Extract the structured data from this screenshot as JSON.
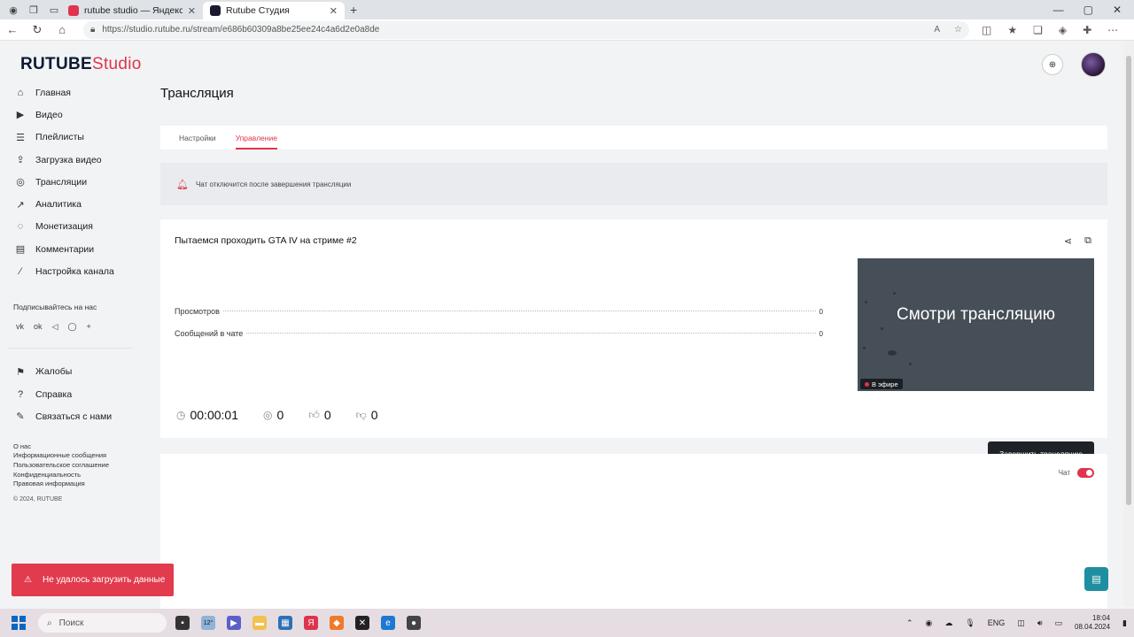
{
  "browser": {
    "tabs": [
      {
        "title": "rutube studio — Яндекс: нашлс",
        "active": false,
        "favicon_color": "#e0334d"
      },
      {
        "title": "Rutube Студия",
        "active": true,
        "favicon_color": "#1a1a2e"
      }
    ],
    "url": "https://studio.rutube.ru/stream/e686b60309a8be25ee24c4a6d2e0a8de"
  },
  "app": {
    "logo_rutube": "RUTUBE",
    "logo_studio": "Studio",
    "page_title": "Трансляция",
    "nav": [
      {
        "label": "Главная",
        "icon": "home-icon"
      },
      {
        "label": "Видео",
        "icon": "video-icon"
      },
      {
        "label": "Плейлисты",
        "icon": "playlist-icon"
      },
      {
        "label": "Загрузка видео",
        "icon": "upload-icon"
      },
      {
        "label": "Трансляции",
        "icon": "broadcast-icon"
      },
      {
        "label": "Аналитика",
        "icon": "analytics-icon"
      },
      {
        "label": "Монетизация",
        "icon": "monetization-icon"
      },
      {
        "label": "Комментарии",
        "icon": "comments-icon"
      },
      {
        "label": "Настройка канала",
        "icon": "wand-icon"
      }
    ],
    "subscribe_label": "Подписывайтесь на нас",
    "socials": [
      "vk",
      "ok",
      "telegram",
      "viber",
      "plus"
    ],
    "secondary_nav": [
      {
        "label": "Жалобы",
        "icon": "flag-icon"
      },
      {
        "label": "Справка",
        "icon": "help-icon"
      },
      {
        "label": "Связаться с нами",
        "icon": "edit-icon"
      }
    ],
    "footer_links": [
      "О нас",
      "Информационные сообщения",
      "Пользовательское соглашение",
      "Конфиденциальность",
      "Правовая информация"
    ],
    "copyright": "© 2024, RUTUBE",
    "tabs": [
      {
        "label": "Настройки",
        "active": false
      },
      {
        "label": "Управление",
        "active": true
      }
    ],
    "notice": "Чат отключится после завершения трансляции",
    "stream": {
      "title": "Пытаемся проходить GTA IV на стриме #2",
      "stats": [
        {
          "label": "Просмотров",
          "value": "0"
        },
        {
          "label": "Сообщений в чате",
          "value": "0"
        }
      ],
      "preview_text": "Смотри трансляцию",
      "live_badge": "В эфире",
      "duration": "00:00:01",
      "viewers": "0",
      "likes": "0",
      "dislikes": "0",
      "end_button": "Завершить трансляцию"
    },
    "chat_label": "Чат",
    "chat_enabled": true,
    "toast": "Не удалось загрузить данные",
    "accent_color": "#e0334d"
  },
  "taskbar": {
    "search_placeholder": "Поиск",
    "weather": "12°",
    "lang": "ENG",
    "time": "18:04",
    "date": "08.04.2024"
  }
}
